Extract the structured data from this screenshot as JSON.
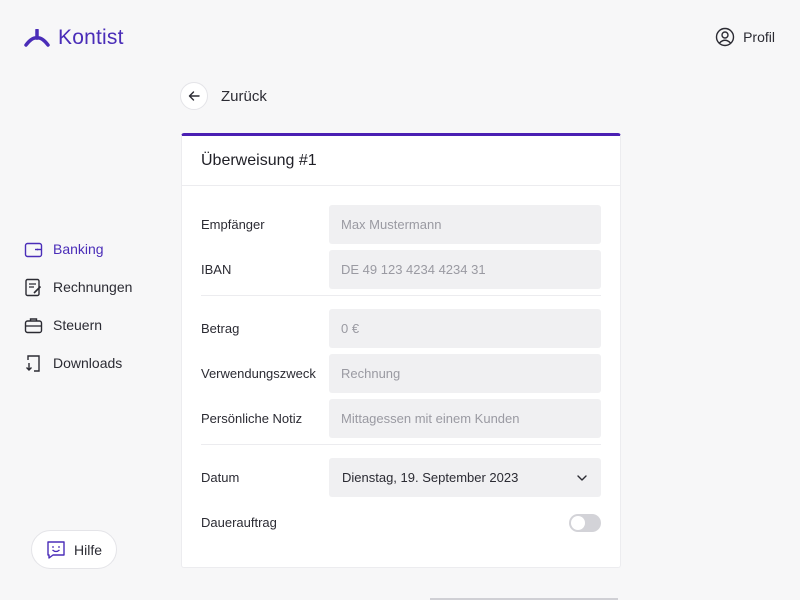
{
  "brand": {
    "name": "Kontist",
    "color": "#4a2db8"
  },
  "header": {
    "profile_label": "Profil",
    "profile_icon": "user-circle-icon"
  },
  "sidebar": {
    "items": [
      {
        "label": "Banking",
        "icon": "wallet-icon",
        "active": true
      },
      {
        "label": "Rechnungen",
        "icon": "invoice-icon",
        "active": false
      },
      {
        "label": "Steuern",
        "icon": "briefcase-icon",
        "active": false
      },
      {
        "label": "Downloads",
        "icon": "download-document-icon",
        "active": false
      }
    ],
    "help_label": "Hilfe"
  },
  "back": {
    "label": "Zurück"
  },
  "card": {
    "title": "Überweisung #1",
    "fields": {
      "recipient": {
        "label": "Empfänger",
        "placeholder": "Max Mustermann",
        "value": ""
      },
      "iban": {
        "label": "IBAN",
        "placeholder": "DE 49 123 4234 4234 31",
        "value": ""
      },
      "amount": {
        "label": "Betrag",
        "placeholder": "0 €",
        "value": ""
      },
      "purpose": {
        "label": "Verwendungszweck",
        "placeholder": "Rechnung",
        "value": ""
      },
      "note": {
        "label": "Persönliche Notiz",
        "placeholder": "Mittagessen mit einem Kunden",
        "value": ""
      },
      "date": {
        "label": "Datum",
        "value": "Dienstag, 19. September 2023"
      },
      "standing_order": {
        "label": "Dauerauftrag",
        "enabled": false
      }
    }
  },
  "colors": {
    "accent": "#4a1fb3",
    "background": "#f7f7f8",
    "field_bg": "#f0f0f2"
  }
}
